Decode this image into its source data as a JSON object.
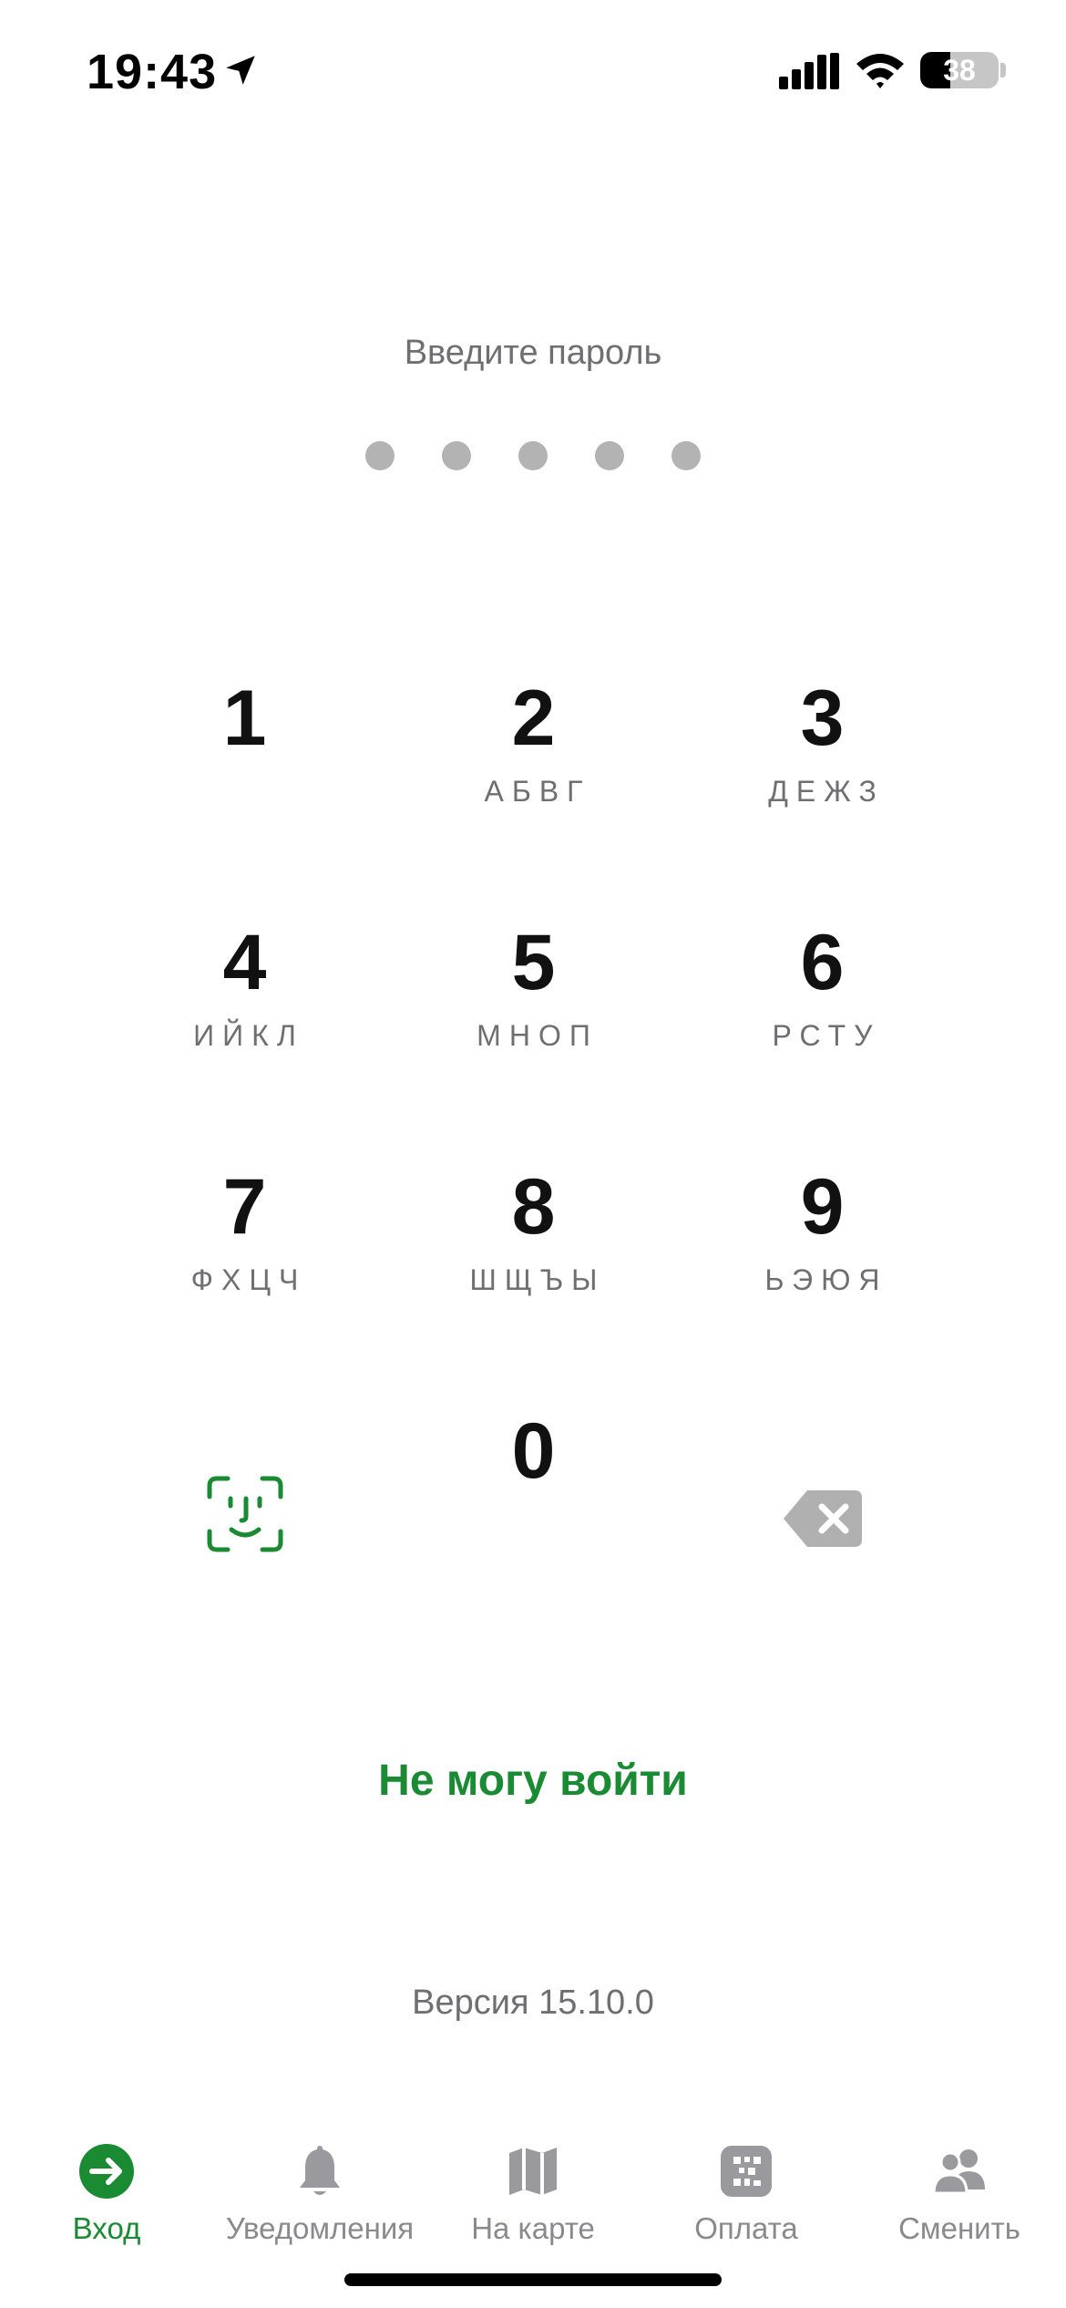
{
  "status_bar": {
    "time": "19:43",
    "battery_percent": 38,
    "battery_label": "38"
  },
  "prompt": "Введите пароль",
  "pin": {
    "length": 5,
    "entered": 0
  },
  "keypad": [
    {
      "digit": "1",
      "letters": ""
    },
    {
      "digit": "2",
      "letters": "АБВГ"
    },
    {
      "digit": "3",
      "letters": "ДЕЖЗ"
    },
    {
      "digit": "4",
      "letters": "ИЙКЛ"
    },
    {
      "digit": "5",
      "letters": "МНОП"
    },
    {
      "digit": "6",
      "letters": "РСТУ"
    },
    {
      "digit": "7",
      "letters": "ФХЦЧ"
    },
    {
      "digit": "8",
      "letters": "ШЩЪЫ"
    },
    {
      "digit": "9",
      "letters": "ЬЭЮЯ"
    },
    {
      "digit": "0",
      "letters": ""
    }
  ],
  "keypad_icons": {
    "left": "face-id-icon",
    "right": "backspace-icon"
  },
  "cant_login": "Не могу войти",
  "version": "Версия 15.10.0",
  "tabs": [
    {
      "label": "Вход",
      "icon": "login-arrow-icon",
      "active": true
    },
    {
      "label": "Уведомления",
      "icon": "bell-icon",
      "active": false
    },
    {
      "label": "На карте",
      "icon": "map-icon",
      "active": false
    },
    {
      "label": "Оплата",
      "icon": "qr-code-icon",
      "active": false
    },
    {
      "label": "Сменить",
      "icon": "users-icon",
      "active": false
    }
  ],
  "colors": {
    "accent": "#1a8a33",
    "text_secondary": "#6e6e73",
    "dot_inactive": "#b3b3b3",
    "icon_inactive": "#9a9a9e"
  }
}
